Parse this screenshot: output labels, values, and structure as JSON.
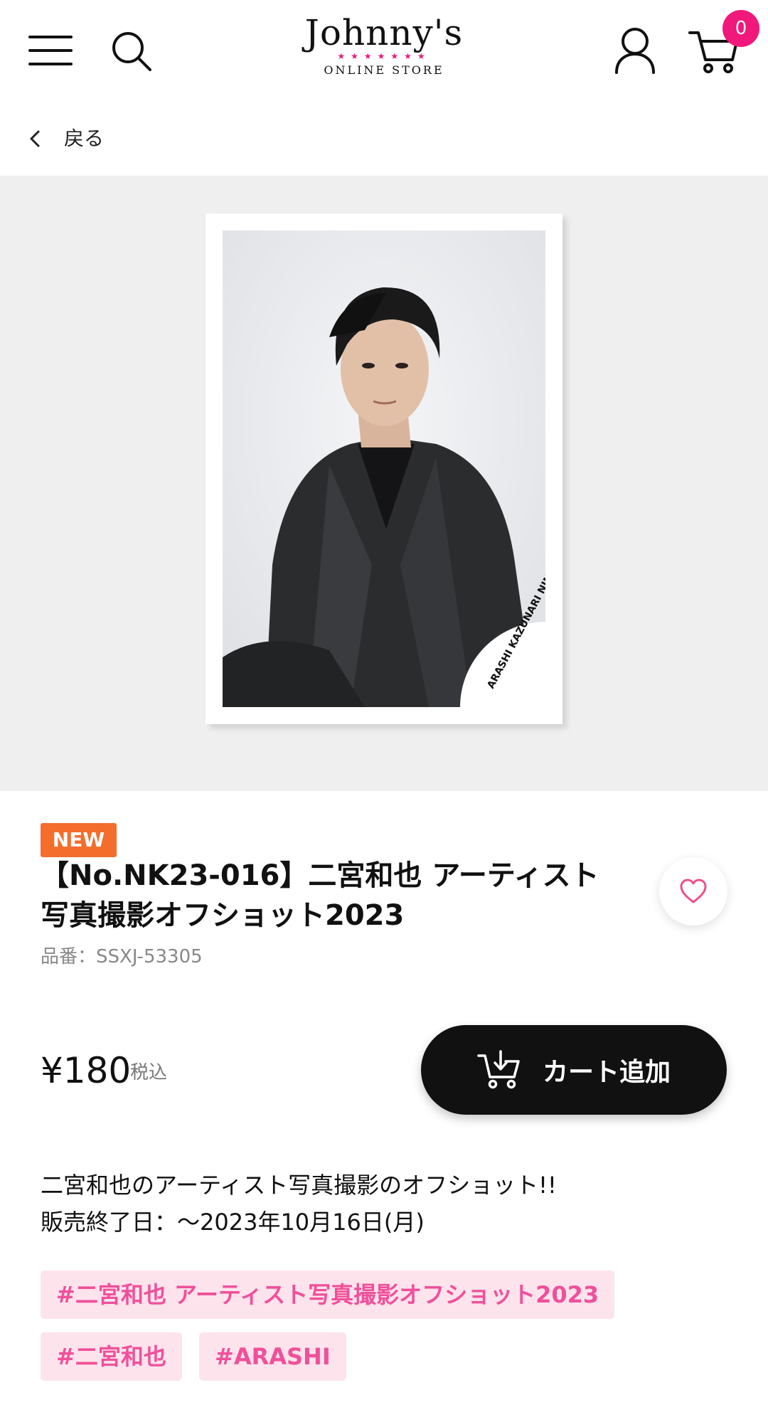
{
  "header": {
    "logo_text": "Johnny's",
    "logo_stars": "★★★★★★★",
    "logo_subtitle": "ONLINE STORE",
    "cart_count": "0"
  },
  "nav": {
    "back_label": "戻る"
  },
  "gallery": {
    "photo_signature": "ARASHI KAZUNARI NINOMIYA"
  },
  "product": {
    "badge": "NEW",
    "title_line1": "【No.NK23-016】二宮和也 アーティスト",
    "title_line2": "写真撮影オフショット2023",
    "sku": "品番：SSXJ-53305",
    "price": "¥180",
    "tax_label": "税込",
    "add_to_cart_label": "カート追加",
    "description_line1": "二宮和也のアーティスト写真撮影のオフショット!!",
    "description_line2": "販売終了日：～2023年10月16日(月)",
    "tags": [
      "#二宮和也 アーティスト写真撮影オフショット2023",
      "#二宮和也",
      "#ARASHI"
    ]
  },
  "colors": {
    "accent": "#f0187a",
    "badge_new": "#f46d2a",
    "tag_bg": "#fde3ec",
    "tag_text": "#f0509a",
    "button_dark": "#111111"
  },
  "icons": [
    "hamburger-menu-icon",
    "search-icon",
    "account-icon",
    "cart-icon",
    "chevron-left-icon",
    "heart-icon",
    "add-to-cart-icon"
  ]
}
